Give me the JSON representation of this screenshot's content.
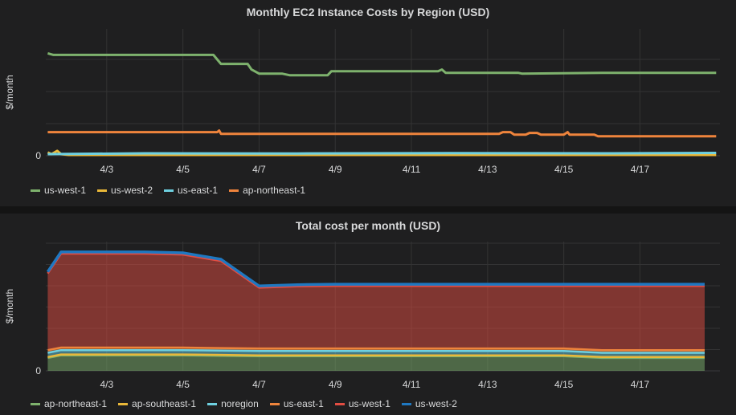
{
  "chart_data": [
    {
      "type": "line",
      "title": "Monthly EC2 Instance Costs by Region (USD)",
      "ylabel": "$/month",
      "yticks": [
        "0"
      ],
      "xticks": [
        "4/3",
        "4/5",
        "4/7",
        "4/9",
        "4/11",
        "4/13",
        "4/15",
        "4/17"
      ],
      "xlim": [
        1.4,
        19.1
      ],
      "ylim": [
        0,
        1560
      ],
      "grid": true,
      "legend_position": "bottom-left",
      "series": [
        {
          "name": "us-west-1",
          "color": "#7eb26d",
          "points": [
            [
              1.45,
              1260
            ],
            [
              1.6,
              1240
            ],
            [
              5.8,
              1240
            ],
            [
              6.0,
              1130
            ],
            [
              6.7,
              1130
            ],
            [
              6.8,
              1060
            ],
            [
              7.0,
              1010
            ],
            [
              7.6,
              1010
            ],
            [
              7.8,
              990
            ],
            [
              8.8,
              990
            ],
            [
              8.9,
              1040
            ],
            [
              11.7,
              1040
            ],
            [
              11.8,
              1060
            ],
            [
              11.9,
              1020
            ],
            [
              12.5,
              1020
            ],
            [
              13.8,
              1020
            ],
            [
              13.9,
              1010
            ],
            [
              16,
              1020
            ],
            [
              19,
              1020
            ]
          ]
        },
        {
          "name": "us-west-2",
          "color": "#eab839",
          "points": [
            [
              1.45,
              40
            ],
            [
              1.55,
              20
            ],
            [
              1.7,
              60
            ],
            [
              1.8,
              20
            ],
            [
              2,
              10
            ],
            [
              19,
              10
            ]
          ]
        },
        {
          "name": "us-east-1",
          "color": "#6ed0e0",
          "points": [
            [
              1.45,
              20
            ],
            [
              4,
              30
            ],
            [
              8,
              28
            ],
            [
              12,
              32
            ],
            [
              16,
              30
            ],
            [
              19,
              35
            ]
          ]
        },
        {
          "name": "ap-northeast-1",
          "color": "#ef843c",
          "points": [
            [
              1.45,
              290
            ],
            [
              5.9,
              290
            ],
            [
              5.95,
              310
            ],
            [
              6.0,
              270
            ],
            [
              13.3,
              270
            ],
            [
              13.4,
              290
            ],
            [
              13.6,
              290
            ],
            [
              13.7,
              260
            ],
            [
              14.0,
              260
            ],
            [
              14.1,
              280
            ],
            [
              14.3,
              280
            ],
            [
              14.4,
              260
            ],
            [
              15.0,
              260
            ],
            [
              15.1,
              290
            ],
            [
              15.15,
              260
            ],
            [
              15.8,
              260
            ],
            [
              15.9,
              240
            ],
            [
              19,
              240
            ]
          ]
        }
      ]
    },
    {
      "type": "area",
      "stacked": true,
      "title": "Total cost per month (USD)",
      "ylabel": "$/month",
      "yticks": [
        "0"
      ],
      "xticks": [
        "4/3",
        "4/5",
        "4/7",
        "4/9",
        "4/11",
        "4/13",
        "4/15",
        "4/17"
      ],
      "xlim": [
        1.4,
        19.1
      ],
      "ylim": [
        0,
        3000
      ],
      "grid": true,
      "legend_position": "bottom-left",
      "x": [
        1.45,
        1.8,
        2,
        3,
        4,
        5,
        6,
        7,
        8,
        9,
        10,
        11,
        12,
        13,
        14,
        15,
        16,
        17,
        18,
        18.7
      ],
      "series": [
        {
          "name": "ap-northeast-1",
          "color": "#7eb26d",
          "values": [
            300,
            360,
            360,
            360,
            360,
            360,
            350,
            340,
            340,
            340,
            340,
            340,
            340,
            340,
            340,
            340,
            300,
            300,
            300,
            300
          ]
        },
        {
          "name": "ap-southeast-1",
          "color": "#eab839",
          "values": [
            20,
            20,
            20,
            20,
            20,
            20,
            20,
            20,
            20,
            20,
            20,
            20,
            20,
            20,
            20,
            20,
            20,
            20,
            20,
            20
          ]
        },
        {
          "name": "noregion",
          "color": "#6ed0e0",
          "values": [
            100,
            100,
            100,
            100,
            100,
            100,
            100,
            100,
            100,
            100,
            100,
            100,
            100,
            100,
            100,
            100,
            100,
            100,
            100,
            100
          ]
        },
        {
          "name": "us-east-1",
          "color": "#ef843c",
          "values": [
            60,
            60,
            60,
            60,
            60,
            60,
            60,
            60,
            60,
            60,
            60,
            60,
            60,
            60,
            60,
            60,
            60,
            60,
            60,
            60
          ]
        },
        {
          "name": "us-west-1",
          "color": "#e24d42",
          "values": [
            1780,
            2180,
            2180,
            2180,
            2180,
            2160,
            2020,
            1410,
            1440,
            1450,
            1450,
            1450,
            1450,
            1450,
            1450,
            1450,
            1490,
            1490,
            1490,
            1490
          ]
        },
        {
          "name": "us-west-2",
          "color": "#1f78c1",
          "values": [
            40,
            40,
            40,
            40,
            40,
            40,
            40,
            40,
            40,
            40,
            40,
            40,
            40,
            40,
            40,
            40,
            40,
            40,
            40,
            40
          ]
        }
      ]
    }
  ]
}
